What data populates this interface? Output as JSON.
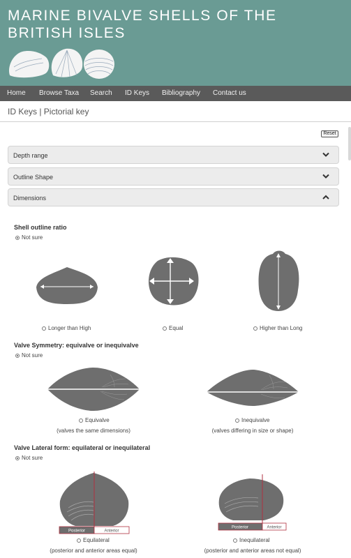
{
  "site": {
    "title": "MARINE BIVALVE SHELLS OF THE BRITISH ISLES"
  },
  "nav": [
    "Home",
    "Browse Taxa",
    "Search",
    "ID Keys",
    "Bibliography",
    "Contact us"
  ],
  "page": {
    "heading": "ID Keys | Pictorial key",
    "reset_label": "Reset"
  },
  "accordions": [
    {
      "label": "Depth range",
      "state": "collapsed",
      "icon": "chevron-down-icon"
    },
    {
      "label": "Outline Shape",
      "state": "collapsed",
      "icon": "chevron-down-icon"
    },
    {
      "label": "Dimensions",
      "state": "expanded",
      "icon": "chevron-up-icon"
    }
  ],
  "questions": {
    "ratio": {
      "title": "Shell outline ratio",
      "not_sure": "Not sure",
      "options": [
        "Longer than High",
        "Equal",
        "Higher than Long"
      ]
    },
    "symmetry": {
      "title": "Valve Symmetry: equivalve or inequivalve",
      "not_sure": "Not sure",
      "options": [
        "Equivalve",
        "Inequivalve"
      ],
      "captions": [
        "(valves the same dimensions)",
        "(valves differing in size or shape)"
      ]
    },
    "lateral": {
      "title": "Valve Lateral form: equilateral or inequilateral",
      "not_sure": "Not sure",
      "options": [
        "Equilateral",
        "Inequilateral"
      ],
      "captions": [
        "(posterior and anterior areas equal)",
        "(posterior and anterior areas not equal)"
      ],
      "posterior": "Posterior",
      "anterior": "Anterior"
    }
  },
  "colors": {
    "header": "#6a9b94",
    "nav": "#5a5a5a",
    "shell": "#6e6e6e",
    "axis": "#b03040"
  }
}
